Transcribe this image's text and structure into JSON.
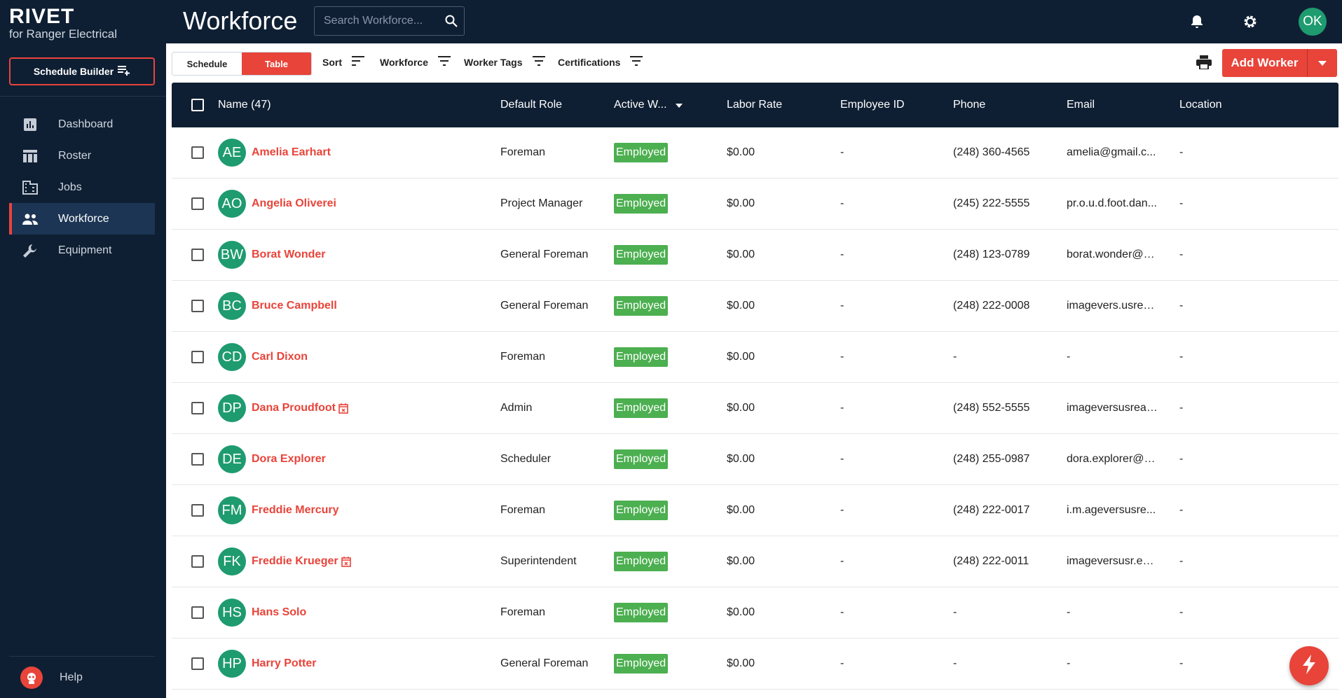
{
  "brand": {
    "name": "RIVET",
    "subtitle": "for Ranger Electrical"
  },
  "sidebar": {
    "schedule_builder": "Schedule Builder",
    "items": [
      {
        "label": "Dashboard",
        "icon": "dashboard-icon",
        "active": false
      },
      {
        "label": "Roster",
        "icon": "roster-icon",
        "active": false
      },
      {
        "label": "Jobs",
        "icon": "jobs-icon",
        "active": false
      },
      {
        "label": "Workforce",
        "icon": "workforce-icon",
        "active": true
      },
      {
        "label": "Equipment",
        "icon": "equipment-icon",
        "active": false
      }
    ],
    "help": "Help"
  },
  "header": {
    "title": "Workforce",
    "search_placeholder": "Search Workforce...",
    "user_initials": "OK"
  },
  "toolbar": {
    "view_schedule": "Schedule",
    "view_table": "Table",
    "filters": [
      "Sort",
      "Workforce",
      "Worker Tags",
      "Certifications"
    ],
    "add_worker": "Add Worker"
  },
  "table": {
    "columns": [
      "Name (47)",
      "Default Role",
      "Active W...",
      "Labor Rate",
      "Employee ID",
      "Phone",
      "Email",
      "Location"
    ],
    "rows": [
      {
        "initials": "AE",
        "name": "Amelia Earhart",
        "cal": false,
        "role": "Foreman",
        "status": "Employed",
        "rate": "$0.00",
        "emp_id": "-",
        "phone": "(248) 360-4565",
        "email": "amelia@gmail.c...",
        "location": "-"
      },
      {
        "initials": "AO",
        "name": "Angelia Oliverei",
        "cal": false,
        "role": "Project Manager",
        "status": "Employed",
        "rate": "$0.00",
        "emp_id": "-",
        "phone": "(245) 222-5555",
        "email": "pr.o.u.d.foot.dan...",
        "location": "-"
      },
      {
        "initials": "BW",
        "name": "Borat Wonder",
        "cal": false,
        "role": "General Foreman",
        "status": "Employed",
        "rate": "$0.00",
        "emp_id": "-",
        "phone": "(248) 123-0789",
        "email": "borat.wonder@g...",
        "location": "-"
      },
      {
        "initials": "BC",
        "name": "Bruce Campbell",
        "cal": false,
        "role": "General Foreman",
        "status": "Employed",
        "rate": "$0.00",
        "emp_id": "-",
        "phone": "(248) 222-0008",
        "email": "imagevers.usrea...",
        "location": "-"
      },
      {
        "initials": "CD",
        "name": "Carl Dixon",
        "cal": false,
        "role": "Foreman",
        "status": "Employed",
        "rate": "$0.00",
        "emp_id": "-",
        "phone": "-",
        "email": "-",
        "location": "-"
      },
      {
        "initials": "DP",
        "name": "Dana Proudfoot",
        "cal": true,
        "role": "Admin",
        "status": "Employed",
        "rate": "$0.00",
        "emp_id": "-",
        "phone": "(248) 552-5555",
        "email": "imageversusreal...",
        "location": "-"
      },
      {
        "initials": "DE",
        "name": "Dora Explorer",
        "cal": false,
        "role": "Scheduler",
        "status": "Employed",
        "rate": "$0.00",
        "emp_id": "-",
        "phone": "(248) 255-0987",
        "email": "dora.explorer@g...",
        "location": "-"
      },
      {
        "initials": "FM",
        "name": "Freddie Mercury",
        "cal": false,
        "role": "Foreman",
        "status": "Employed",
        "rate": "$0.00",
        "emp_id": "-",
        "phone": "(248) 222-0017",
        "email": "i.m.ageversusre...",
        "location": "-"
      },
      {
        "initials": "FK",
        "name": "Freddie Krueger",
        "cal": true,
        "role": "Superintendent",
        "status": "Employed",
        "rate": "$0.00",
        "emp_id": "-",
        "phone": "(248) 222-0011",
        "email": "imageversusr.ea...",
        "location": "-"
      },
      {
        "initials": "HS",
        "name": "Hans Solo",
        "cal": false,
        "role": "Foreman",
        "status": "Employed",
        "rate": "$0.00",
        "emp_id": "-",
        "phone": "-",
        "email": "-",
        "location": "-"
      },
      {
        "initials": "HP",
        "name": "Harry Potter",
        "cal": false,
        "role": "General Foreman",
        "status": "Employed",
        "rate": "$0.00",
        "emp_id": "-",
        "phone": "-",
        "email": "-",
        "location": "-"
      }
    ]
  },
  "colors": {
    "navy": "#0f1f33",
    "accent": "#e8443a",
    "avatar": "#1e9b6f",
    "employed": "#4caf50"
  }
}
